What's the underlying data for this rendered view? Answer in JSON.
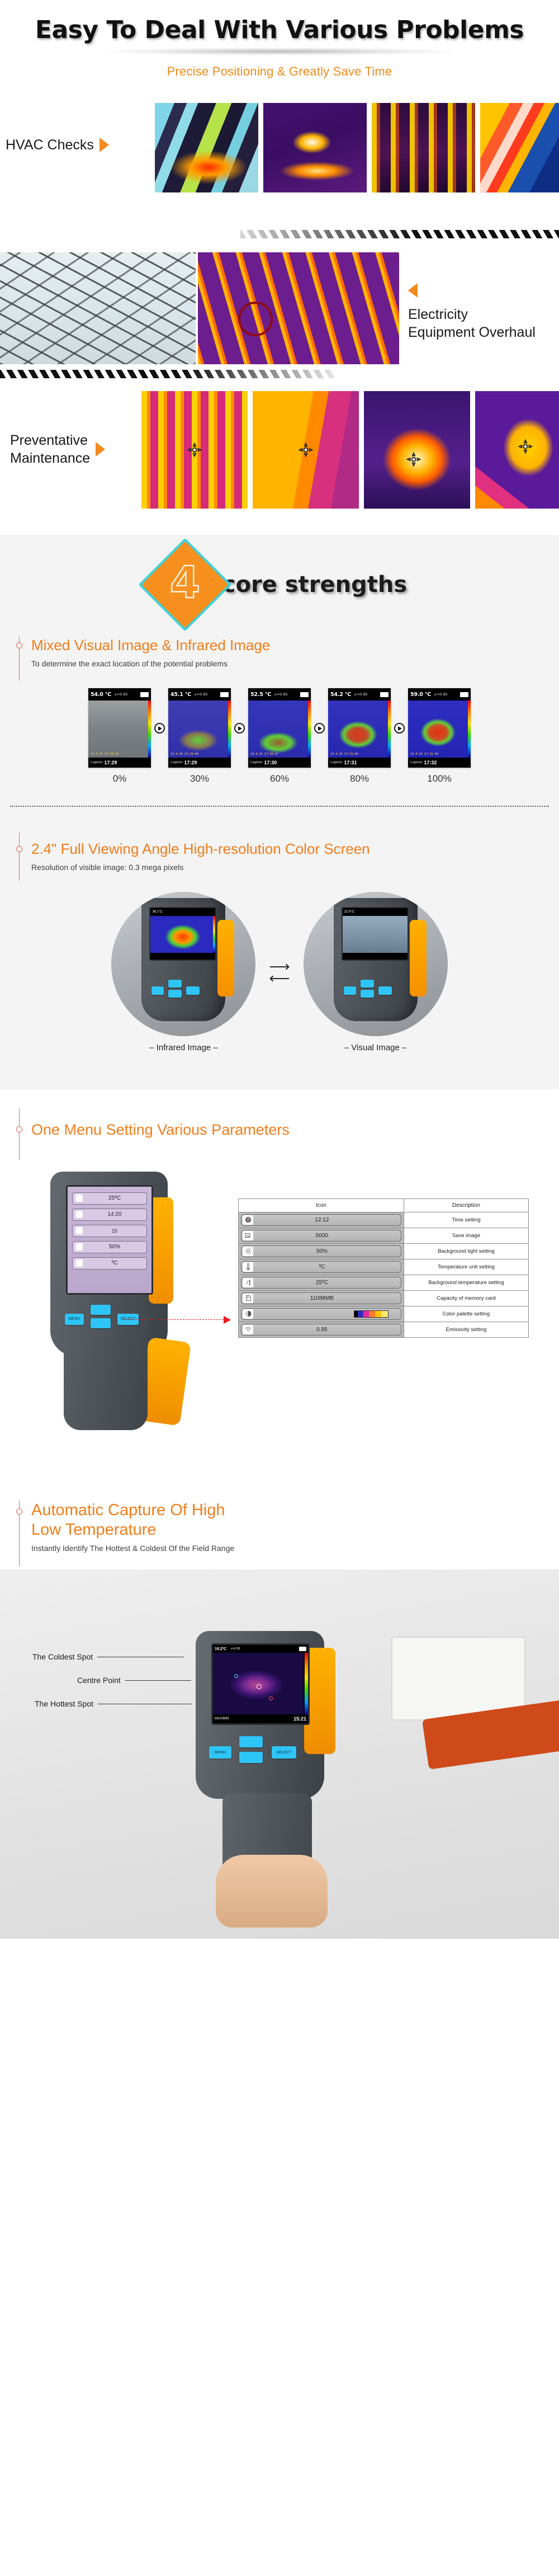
{
  "hero": {
    "title": "Easy To Deal With Various Problems",
    "subtitle": "Precise Positioning & Greatly Save Time"
  },
  "applications": [
    {
      "label": "HVAC Checks",
      "arrow": "right"
    },
    {
      "label_line1": "Electricity",
      "label_line2": "Equipment Overhaul",
      "arrow": "left"
    },
    {
      "label_line1": "Preventative",
      "label_line2": "Maintenance",
      "arrow": "right"
    }
  ],
  "core": {
    "badge_number": "4",
    "title": "core strengths",
    "accent_orange": "#f7901e",
    "accent_teal": "#3fd0d8",
    "rail_color": "#e2665a"
  },
  "features": [
    {
      "heading": "Mixed Visual Image & Infrared Image",
      "sub": "To determine the exact location of the potential problems"
    },
    {
      "heading": "2.4\" Full Viewing Angle High-resolution Color Screen",
      "sub": "Resolution of visible image: 0.3 mega pixels"
    },
    {
      "heading": "One Menu Setting Various Parameters",
      "sub": ""
    },
    {
      "heading_line1": "Automatic Capture Of High",
      "heading_line2": "Low Temperature",
      "sub": "Instantly Identify The Hottest & Coldest Of the Field Range"
    }
  ],
  "fusion": {
    "shots": [
      {
        "temp": "54.0 °C",
        "emissivity": "ε=0.95",
        "stamp": "13-4-25 17:29:19",
        "capture_label": "Capture",
        "capture_time": "17:29",
        "percent": "0%"
      },
      {
        "temp": "45.1 °C",
        "emissivity": "ε=0.95",
        "stamp": "13-4-25 17:29:48",
        "capture_label": "Capture",
        "capture_time": "17:29",
        "percent": "30%"
      },
      {
        "temp": "52.5 °C",
        "emissivity": "ε=0.95",
        "stamp": "13-4-25 17:30:47",
        "capture_label": "Capture",
        "capture_time": "17:30",
        "percent": "60%"
      },
      {
        "temp": "54.2 °C",
        "emissivity": "ε=0.95",
        "stamp": "13-4-25 17:31:46",
        "capture_label": "Capture",
        "capture_time": "17:31",
        "percent": "80%"
      },
      {
        "temp": "59.0 °C",
        "emissivity": "ε=0.95",
        "stamp": "13-4-25 17:32:40",
        "capture_label": "Capture",
        "capture_time": "17:32",
        "percent": "100%"
      }
    ]
  },
  "screen_demo": {
    "left_caption": "– Infrared Image –",
    "right_caption": "–   Visual Image   –",
    "left_screen_temp": "36.1°C",
    "right_screen_temp": "22.9°C"
  },
  "settings_table": {
    "header_icon": "Icon",
    "header_description": "Description",
    "rows": [
      {
        "icon": "clock-icon",
        "value": "12:12",
        "description": "Time setting"
      },
      {
        "icon": "photos-icon",
        "value": "5000",
        "description": "Save image"
      },
      {
        "icon": "brightness-icon",
        "value": "50%",
        "description": "Background light setting"
      },
      {
        "icon": "thermometer-icon",
        "value": "ºC",
        "description": "Temperature unit setting"
      },
      {
        "icon": "ambient-temp-icon",
        "value": "25ºC",
        "description": "Background temperature setting"
      },
      {
        "icon": "memory-card-icon",
        "value": "11088MB",
        "description": "Capacity of memory card"
      },
      {
        "icon": "contrast-icon",
        "value": "",
        "description": "Color palette setting"
      },
      {
        "icon": "emissivity-icon",
        "value": "0.95",
        "description": "Emissivity setting"
      }
    ]
  },
  "capture_section": {
    "labels": [
      "The Coldest Spot",
      "Centre Point",
      "The Hottest Spot"
    ],
    "screen_temp": "19.2ºC",
    "screen_emissivity": "ε=0.95",
    "screen_time": "15:21",
    "screen_mode": "MAX/MIN"
  }
}
